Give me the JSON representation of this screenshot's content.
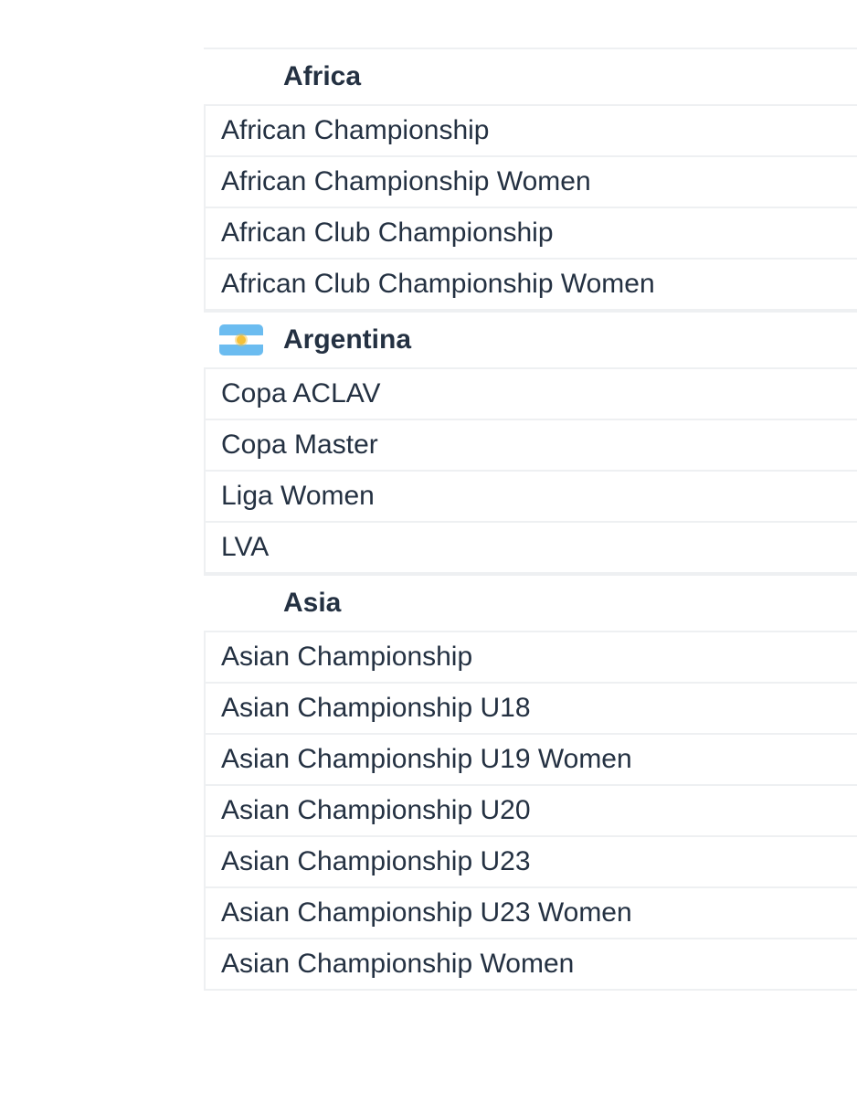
{
  "groups": [
    {
      "title": "Africa",
      "items": [
        "African Championship",
        "African Championship Women",
        "African Club Championship",
        "African Club Championship Women"
      ]
    },
    {
      "title": "Argentina",
      "flag_icon": "argentina-flag-icon",
      "flag_colors": {
        "blue": "#6bbcf0",
        "white": "#ffffff",
        "sun": "#f5c13a"
      },
      "items": [
        "Copa ACLAV",
        "Copa Master",
        "Liga Women",
        "LVA"
      ]
    },
    {
      "title": "Asia",
      "items": [
        "Asian Championship",
        "Asian Championship U18",
        "Asian Championship U19 Women",
        "Asian Championship U20",
        "Asian Championship U23",
        "Asian Championship U23 Women",
        "Asian Championship Women"
      ]
    }
  ]
}
